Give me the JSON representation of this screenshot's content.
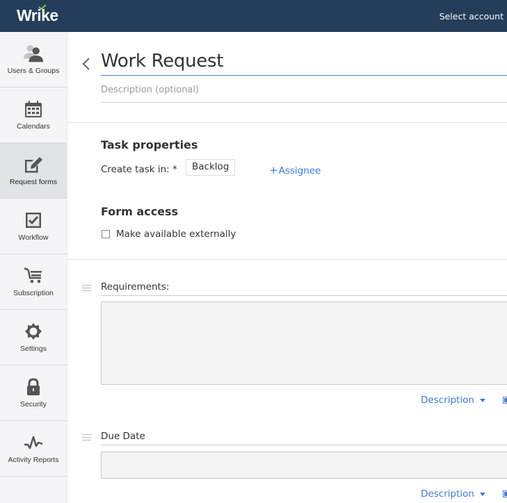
{
  "topbar": {
    "logo": "Wrike",
    "select_account": "Select account",
    "brand_color": "#243d5a",
    "logo_check_color": "#8bc34a"
  },
  "sidebar": {
    "items": [
      {
        "label": "Users & Groups",
        "icon": "users-groups-icon",
        "active": false
      },
      {
        "label": "Calendars",
        "icon": "calendar-icon",
        "active": false
      },
      {
        "label": "Request forms",
        "icon": "request-form-edit-icon",
        "active": true
      },
      {
        "label": "Workflow",
        "icon": "workflow-checkbox-icon",
        "active": false
      },
      {
        "label": "Subscription",
        "icon": "shopping-cart-icon",
        "active": false
      },
      {
        "label": "Settings",
        "icon": "gear-icon",
        "active": false
      },
      {
        "label": "Security",
        "icon": "lock-icon",
        "active": false
      },
      {
        "label": "Activity Reports",
        "icon": "activity-pulse-icon",
        "active": false
      }
    ]
  },
  "form": {
    "title_value": "Work Request",
    "description_placeholder": "Description (optional)",
    "task_properties": {
      "heading": "Task properties",
      "create_task_label": "Create task in: *",
      "create_task_value": "Backlog",
      "assignee_plus": "+",
      "assignee_label": "Assignee"
    },
    "form_access": {
      "heading": "Form access",
      "make_external_label": "Make available externally",
      "make_external_checked": false
    },
    "fields": [
      {
        "label": "Requirements:",
        "dropdown_label": "Description"
      },
      {
        "label": "Due Date",
        "dropdown_label": "Description"
      }
    ],
    "accent_color": "#3d7ad4"
  }
}
